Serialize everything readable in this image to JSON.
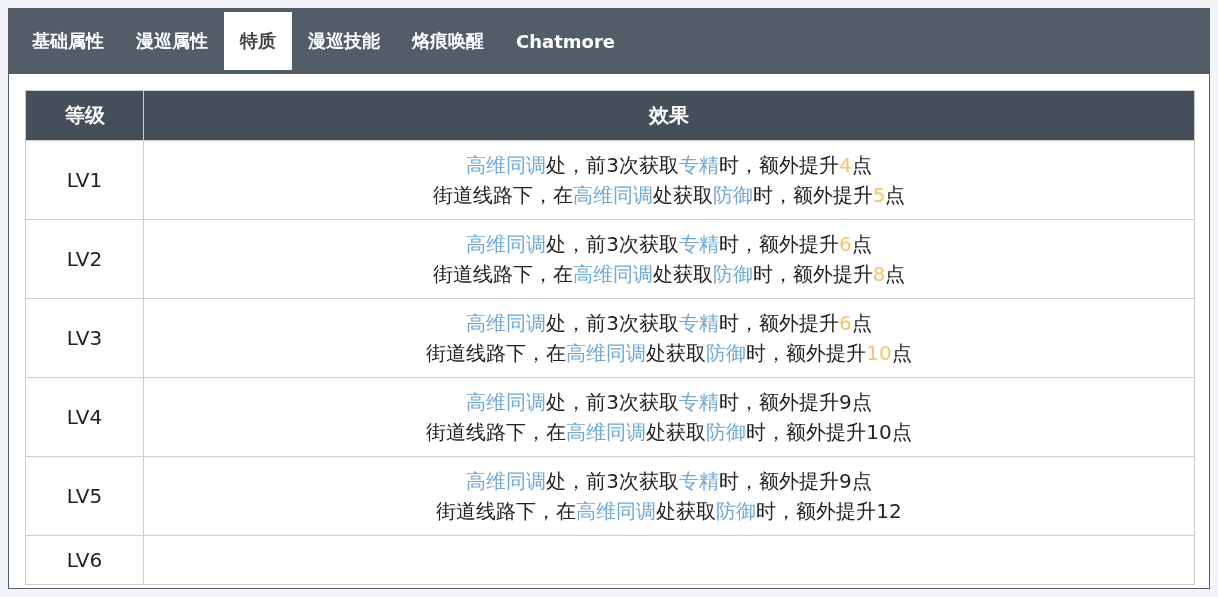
{
  "tabs": [
    {
      "label": "基础属性",
      "selected": false
    },
    {
      "label": "漫巡属性",
      "selected": false
    },
    {
      "label": "特质",
      "selected": true
    },
    {
      "label": "漫巡技能",
      "selected": false
    },
    {
      "label": "烙痕唤醒",
      "selected": false
    },
    {
      "label": "Chatmore",
      "selected": false
    }
  ],
  "table": {
    "columns": [
      "等级",
      "效果"
    ],
    "rows": [
      {
        "level": "LV1",
        "lines": [
          [
            {
              "kind": "term",
              "text": "高维同调"
            },
            {
              "kind": "plain",
              "text": "处，前3次获取"
            },
            {
              "kind": "term",
              "text": "专精"
            },
            {
              "kind": "plain",
              "text": "时，额外提升"
            },
            {
              "kind": "num",
              "text": "4"
            },
            {
              "kind": "plain",
              "text": "点"
            }
          ],
          [
            {
              "kind": "plain",
              "text": "街道线路下，在"
            },
            {
              "kind": "term",
              "text": "高维同调"
            },
            {
              "kind": "plain",
              "text": "处获取"
            },
            {
              "kind": "term",
              "text": "防御"
            },
            {
              "kind": "plain",
              "text": "时，额外提升"
            },
            {
              "kind": "num",
              "text": "5"
            },
            {
              "kind": "plain",
              "text": "点"
            }
          ]
        ]
      },
      {
        "level": "LV2",
        "lines": [
          [
            {
              "kind": "term",
              "text": "高维同调"
            },
            {
              "kind": "plain",
              "text": "处，前3次获取"
            },
            {
              "kind": "term",
              "text": "专精"
            },
            {
              "kind": "plain",
              "text": "时，额外提升"
            },
            {
              "kind": "num",
              "text": "6"
            },
            {
              "kind": "plain",
              "text": "点"
            }
          ],
          [
            {
              "kind": "plain",
              "text": "街道线路下，在"
            },
            {
              "kind": "term",
              "text": "高维同调"
            },
            {
              "kind": "plain",
              "text": "处获取"
            },
            {
              "kind": "term",
              "text": "防御"
            },
            {
              "kind": "plain",
              "text": "时，额外提升"
            },
            {
              "kind": "num",
              "text": "8"
            },
            {
              "kind": "plain",
              "text": "点"
            }
          ]
        ]
      },
      {
        "level": "LV3",
        "lines": [
          [
            {
              "kind": "term",
              "text": "高维同调"
            },
            {
              "kind": "plain",
              "text": "处，前3次获取"
            },
            {
              "kind": "term",
              "text": "专精"
            },
            {
              "kind": "plain",
              "text": "时，额外提升"
            },
            {
              "kind": "num",
              "text": "6"
            },
            {
              "kind": "plain",
              "text": "点"
            }
          ],
          [
            {
              "kind": "plain",
              "text": "街道线路下，在"
            },
            {
              "kind": "term",
              "text": "高维同调"
            },
            {
              "kind": "plain",
              "text": "处获取"
            },
            {
              "kind": "term",
              "text": "防御"
            },
            {
              "kind": "plain",
              "text": "时，额外提升"
            },
            {
              "kind": "num",
              "text": "10"
            },
            {
              "kind": "plain",
              "text": "点"
            }
          ]
        ]
      },
      {
        "level": "LV4",
        "lines": [
          [
            {
              "kind": "term",
              "text": "高维同调"
            },
            {
              "kind": "plain",
              "text": "处，前3次获取"
            },
            {
              "kind": "term",
              "text": "专精"
            },
            {
              "kind": "plain",
              "text": "时，额外提升9点"
            }
          ],
          [
            {
              "kind": "plain",
              "text": "街道线路下，在"
            },
            {
              "kind": "term",
              "text": "高维同调"
            },
            {
              "kind": "plain",
              "text": "处获取"
            },
            {
              "kind": "term",
              "text": "防御"
            },
            {
              "kind": "plain",
              "text": "时，额外提升10点"
            }
          ]
        ]
      },
      {
        "level": "LV5",
        "lines": [
          [
            {
              "kind": "term",
              "text": "高维同调"
            },
            {
              "kind": "plain",
              "text": "处，前3次获取"
            },
            {
              "kind": "term",
              "text": "专精"
            },
            {
              "kind": "plain",
              "text": "时，额外提升9点"
            }
          ],
          [
            {
              "kind": "plain",
              "text": "街道线路下，在"
            },
            {
              "kind": "term",
              "text": "高维同调"
            },
            {
              "kind": "plain",
              "text": "处获取"
            },
            {
              "kind": "term",
              "text": "防御"
            },
            {
              "kind": "plain",
              "text": "时，额外提升12"
            }
          ]
        ]
      },
      {
        "level": "LV6"
      }
    ]
  }
}
